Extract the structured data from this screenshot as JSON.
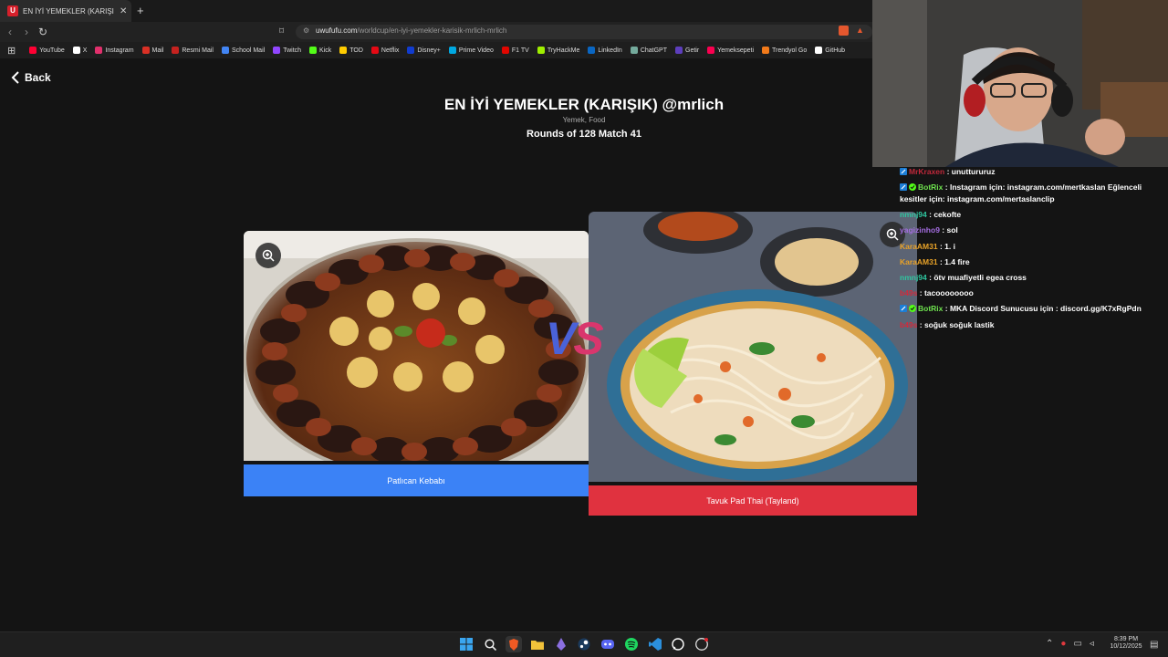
{
  "browser": {
    "tab_title": "EN İYİ YEMEKLER (KARIŞIK) @mr",
    "tab_favicon": "U",
    "url_host": "uwufufu.com",
    "url_path": "/worldcup/en-iyi-yemekler-karisik-mrlich-mrlich",
    "bookmarks": [
      "YouTube",
      "X",
      "Instagram",
      "Mail",
      "Resmi Mail",
      "School Mail",
      "Twitch",
      "Kick",
      "TOD",
      "Netflix",
      "Disney+",
      "Prime Video",
      "F1 TV",
      "TryHackMe",
      "LinkedIn",
      "ChatGPT",
      "Getir",
      "Yemeksepeti",
      "Trendyol Go",
      "GitHub"
    ]
  },
  "page": {
    "back_label": "Back",
    "title": "EN İYİ YEMEKLER (KARIŞIK) @mrlich",
    "subtitle": "Yemek, Food",
    "round": "Rounds of 128 Match 41",
    "vs_v": "V",
    "vs_s": "S",
    "left_choice": "Patlıcan Kebabı",
    "right_choice": "Tavuk Pad Thai (Tayland)"
  },
  "chat": [
    {
      "user": "MrKraxen",
      "text": "unuttururuz",
      "color": "#c0283a",
      "badge": true
    },
    {
      "user": "BotRix",
      "text": "Instagram için: instagram.com/mertkaslan Eğlenceli kesitler için: instagram.com/mertaslanclip",
      "color": "#6ee24e",
      "badge": true,
      "bot": true
    },
    {
      "user": "nmnj94",
      "text": "cekofte",
      "color": "#2fc6a0"
    },
    {
      "user": "yagizinho9",
      "text": "sol",
      "color": "#a46de0"
    },
    {
      "user": "KaraAM31",
      "text": "1. i",
      "color": "#e8a228"
    },
    {
      "user": "KaraAM31",
      "text": "1.4 fire",
      "color": "#e8a228"
    },
    {
      "user": "nmnj94",
      "text": "ötv muafiyetli egea cross",
      "color": "#2fc6a0"
    },
    {
      "user": "b49s",
      "text": "tacoooooooo",
      "color": "#d12b3c"
    },
    {
      "user": "BotRix",
      "text": "MKA Discord Sunucusu için : discord.gg/K7xRgPdn",
      "color": "#6ee24e",
      "badge": true,
      "bot": true
    },
    {
      "user": "b49s",
      "text": "soğuk soğuk lastik",
      "color": "#d12b3c"
    }
  ],
  "taskbar": {
    "time": "8:39 PM",
    "date": "10/12/2025"
  }
}
